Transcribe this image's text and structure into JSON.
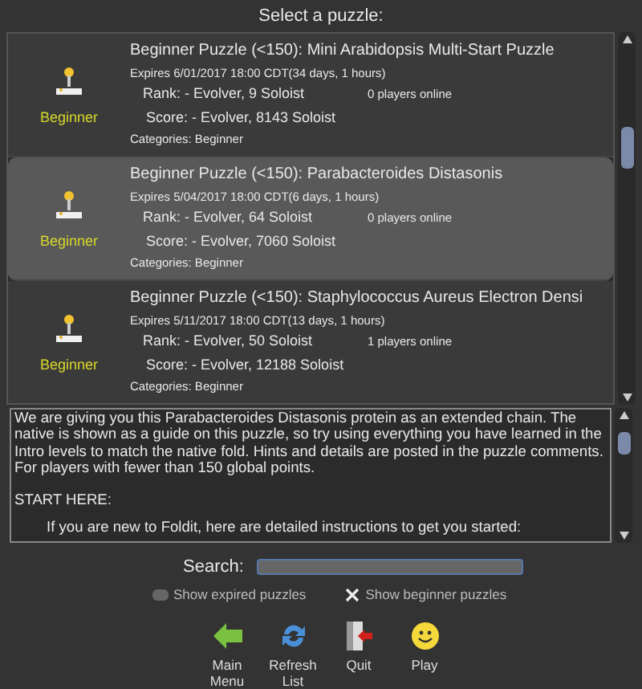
{
  "title": "Select a puzzle:",
  "puzzles": [
    {
      "badge": "Beginner",
      "title": "Beginner Puzzle (<150): Mini Arabidopsis Multi-Start Puzzle",
      "expires": "Expires 6/01/2017 18:00 CDT(34 days, 1 hours)",
      "rank": "Rank: - Evolver, 9 Soloist",
      "players": "0 players online",
      "score": "Score: - Evolver, 8143 Soloist",
      "categories": "Categories: Beginner",
      "selected": false
    },
    {
      "badge": "Beginner",
      "title": "Beginner Puzzle (<150): Parabacteroides Distasonis",
      "expires": "Expires 5/04/2017 18:00 CDT(6 days, 1 hours)",
      "rank": "Rank: - Evolver, 64 Soloist",
      "players": "0 players online",
      "score": "Score: - Evolver, 7060 Soloist",
      "categories": "Categories: Beginner",
      "selected": true
    },
    {
      "badge": "Beginner",
      "title": "Beginner Puzzle (<150): Staphylococcus Aureus Electron Densi",
      "expires": "Expires 5/11/2017 18:00 CDT(13 days, 1 hours)",
      "rank": "Rank: - Evolver, 50 Soloist",
      "players": "1 players online",
      "score": "Score: - Evolver, 12188 Soloist",
      "categories": "Categories: Beginner",
      "selected": false
    }
  ],
  "description": [
    {
      "kind": "text",
      "text": "We are giving you this Parabacteroides Distasonis protein as an extended chain. The native is shown as a guide on this puzzle, so try using everything you have learned in the Intro levels to match the native fold. Hints and details are posted in the puzzle comments. For players with fewer than 150 global points."
    },
    {
      "kind": "text",
      "text": "START HERE:"
    },
    {
      "kind": "indented",
      "text": "If you are new to Foldit, here are detailed instructions to get you started:"
    }
  ],
  "search": {
    "label": "Search:"
  },
  "filters": [
    {
      "label": "Show expired puzzles",
      "checked": false
    },
    {
      "label": "Show beginner puzzles",
      "checked": true
    }
  ],
  "actions": [
    {
      "kind": "back",
      "label": "Main Menu"
    },
    {
      "kind": "refresh",
      "label": "Refresh List"
    },
    {
      "kind": "quit",
      "label": "Quit"
    },
    {
      "kind": "play",
      "label": "Play"
    }
  ]
}
